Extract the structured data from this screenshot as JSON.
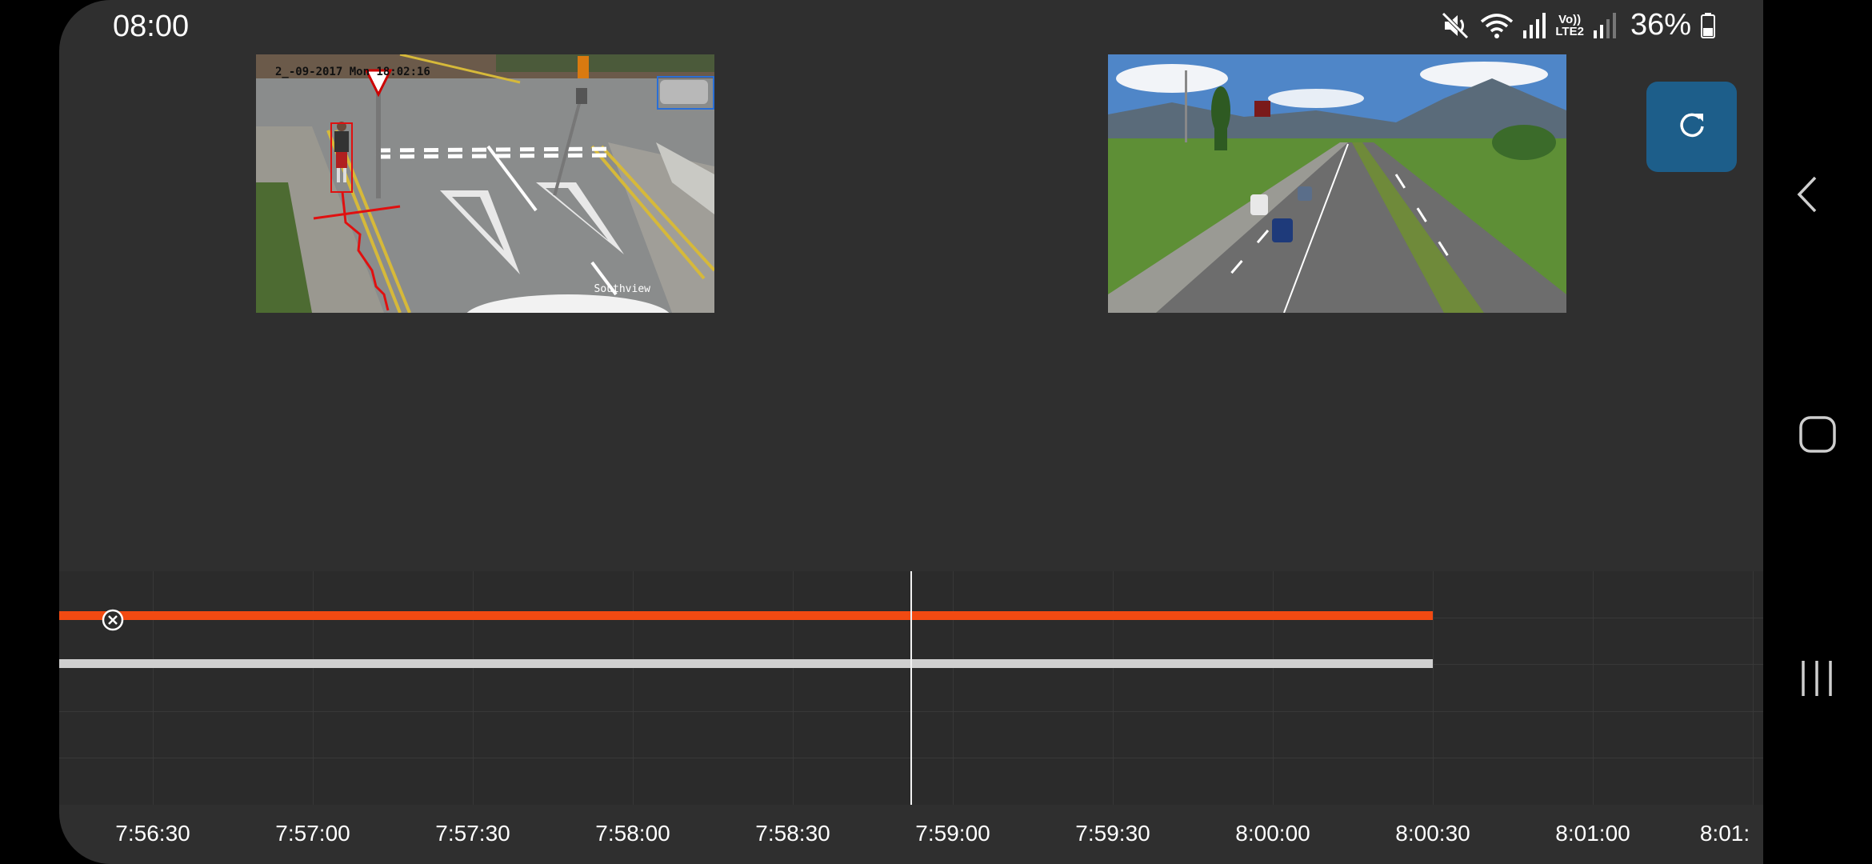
{
  "status_bar": {
    "time": "08:00",
    "network_label_top": "Vo))",
    "network_label_bottom": "LTE2",
    "battery": "36%"
  },
  "cameras": [
    {
      "timestamp": "2_-09-2017 Mon 18:02:16",
      "brand": "Southview"
    },
    {
      "timestamp": "",
      "brand": ""
    }
  ],
  "controls": {
    "refresh_icon": "refresh-icon"
  },
  "timeline": {
    "ticks": [
      "7:56:30",
      "7:57:00",
      "7:57:30",
      "7:58:00",
      "7:58:30",
      "7:59:00",
      "7:59:30",
      "8:00:00",
      "8:00:30",
      "8:01:00",
      "8:01:"
    ],
    "accent_color": "#f24a12",
    "secondary_color": "#cfcfcf"
  },
  "nav_bar": {
    "back_icon": "back-chevron-icon",
    "home_icon": "home-icon",
    "recents_icon": "recents-icon"
  }
}
